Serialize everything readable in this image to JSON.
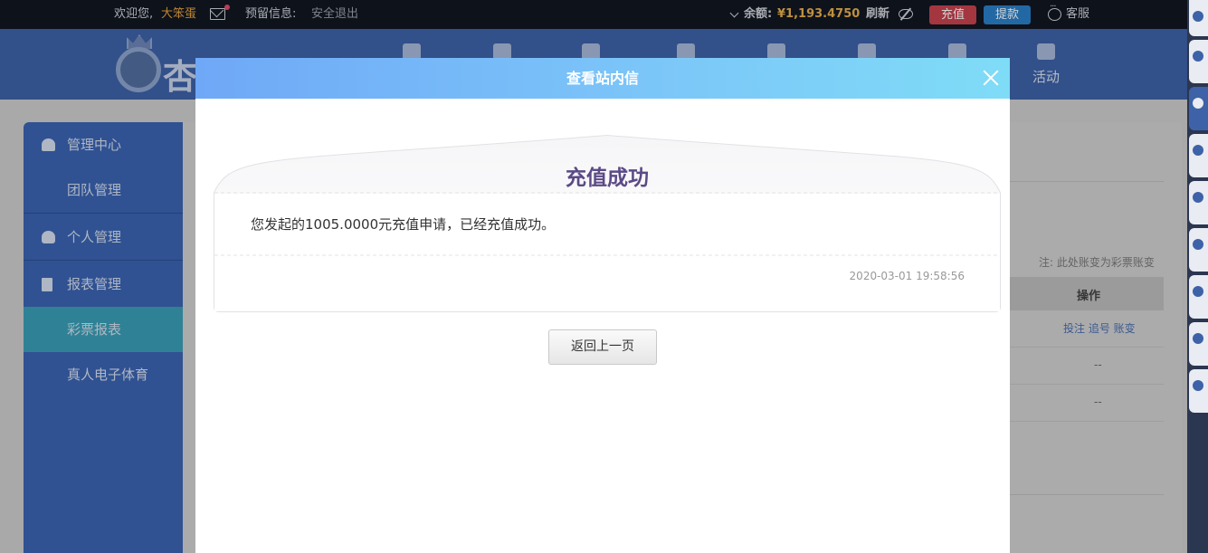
{
  "topbar": {
    "welcome": "欢迎您,",
    "username": "大笨蛋",
    "reserved_info": "预留信息:",
    "logout": "安全退出",
    "balance_label": "余额:",
    "balance_value": "¥1,193.4750",
    "refresh": "刷新",
    "recharge": "充值",
    "withdraw": "提款",
    "service": "客服"
  },
  "header": {
    "logo_text": "杏",
    "nav": [
      {
        "label": ""
      },
      {
        "label": ""
      },
      {
        "label": ""
      },
      {
        "label": ""
      },
      {
        "label": ""
      },
      {
        "label": ""
      },
      {
        "label": ""
      },
      {
        "label": "活动"
      }
    ]
  },
  "sidebar": {
    "items": [
      {
        "label": "管理中心"
      },
      {
        "label": "团队管理"
      },
      {
        "label": "个人管理"
      },
      {
        "label": "报表管理"
      },
      {
        "label": "彩票报表"
      },
      {
        "label": "真人电子体育"
      }
    ]
  },
  "background_table": {
    "note": "注: 此处账变为彩票账变",
    "op_header": "操作",
    "row1_ops": "投注 追号 账变",
    "row2_op": "--",
    "row3_op": "--"
  },
  "modal": {
    "title": "查看站内信",
    "message_title": "充值成功",
    "message_body": "您发起的1005.0000元充值申请，已经充值成功。",
    "message_date": "2020-03-01 19:58:56",
    "back_label": "返回上一页"
  },
  "colors": {
    "header_bg": "#3d62a8",
    "modal_header_start": "#6fa8f7",
    "modal_header_end": "#7fdcf7",
    "message_title": "#5b4a86",
    "recharge_btn": "#c9424f",
    "withdraw_btn": "#2a7fc9",
    "balance": "#e8b04e"
  }
}
